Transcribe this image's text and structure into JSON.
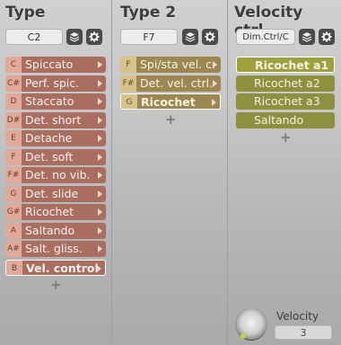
{
  "columns": [
    {
      "title": "Type",
      "selector": "C2",
      "items": [
        {
          "key": "C",
          "label": "Spiccato",
          "highlight": false
        },
        {
          "key": "C#",
          "label": "Perf. spic.",
          "highlight": false
        },
        {
          "key": "D",
          "label": "Staccato",
          "highlight": false
        },
        {
          "key": "D#",
          "label": "Det. short",
          "highlight": false
        },
        {
          "key": "E",
          "label": "Detache",
          "highlight": false
        },
        {
          "key": "F",
          "label": "Det. soft",
          "highlight": false
        },
        {
          "key": "F#",
          "label": "Det. no vib.",
          "highlight": false
        },
        {
          "key": "G",
          "label": "Det. slide",
          "highlight": false
        },
        {
          "key": "G#",
          "label": "Ricochet",
          "highlight": false
        },
        {
          "key": "A",
          "label": "Saltando",
          "highlight": false
        },
        {
          "key": "A#",
          "label": "Salt. gliss.",
          "highlight": false
        },
        {
          "key": "B",
          "label": "Vel. control",
          "highlight": true
        }
      ]
    },
    {
      "title": "Type 2",
      "selector": "F7",
      "items": [
        {
          "key": "F",
          "label": "Spi/sta vel. c.",
          "highlight": false
        },
        {
          "key": "F#",
          "label": "Det. vel. ctrl.",
          "highlight": false
        },
        {
          "key": "G",
          "label": "Ricochet",
          "highlight": true
        }
      ]
    },
    {
      "title": "Velocity ctrl.",
      "selector": "Dim.Ctrl/C",
      "items": [
        {
          "key": "",
          "label": "Ricochet a1",
          "highlight": true
        },
        {
          "key": "",
          "label": "Ricochet a2",
          "highlight": false
        },
        {
          "key": "",
          "label": "Ricochet a3",
          "highlight": false
        },
        {
          "key": "",
          "label": "Saltando",
          "highlight": false
        }
      ]
    }
  ],
  "icons": {
    "layers": "layers-icon",
    "settings": "gear-icon",
    "add": "plus-icon"
  },
  "add_symbol": "+",
  "velocity": {
    "label": "Velocity",
    "value": "3"
  },
  "colors": {
    "col1_item": "#a96e60",
    "col1_key": "#e0a999",
    "col2_item": "#9c8753",
    "col2_key": "#d7c28b",
    "col3_item": "#8e8f3f",
    "col3_key": "#c7c76e"
  }
}
